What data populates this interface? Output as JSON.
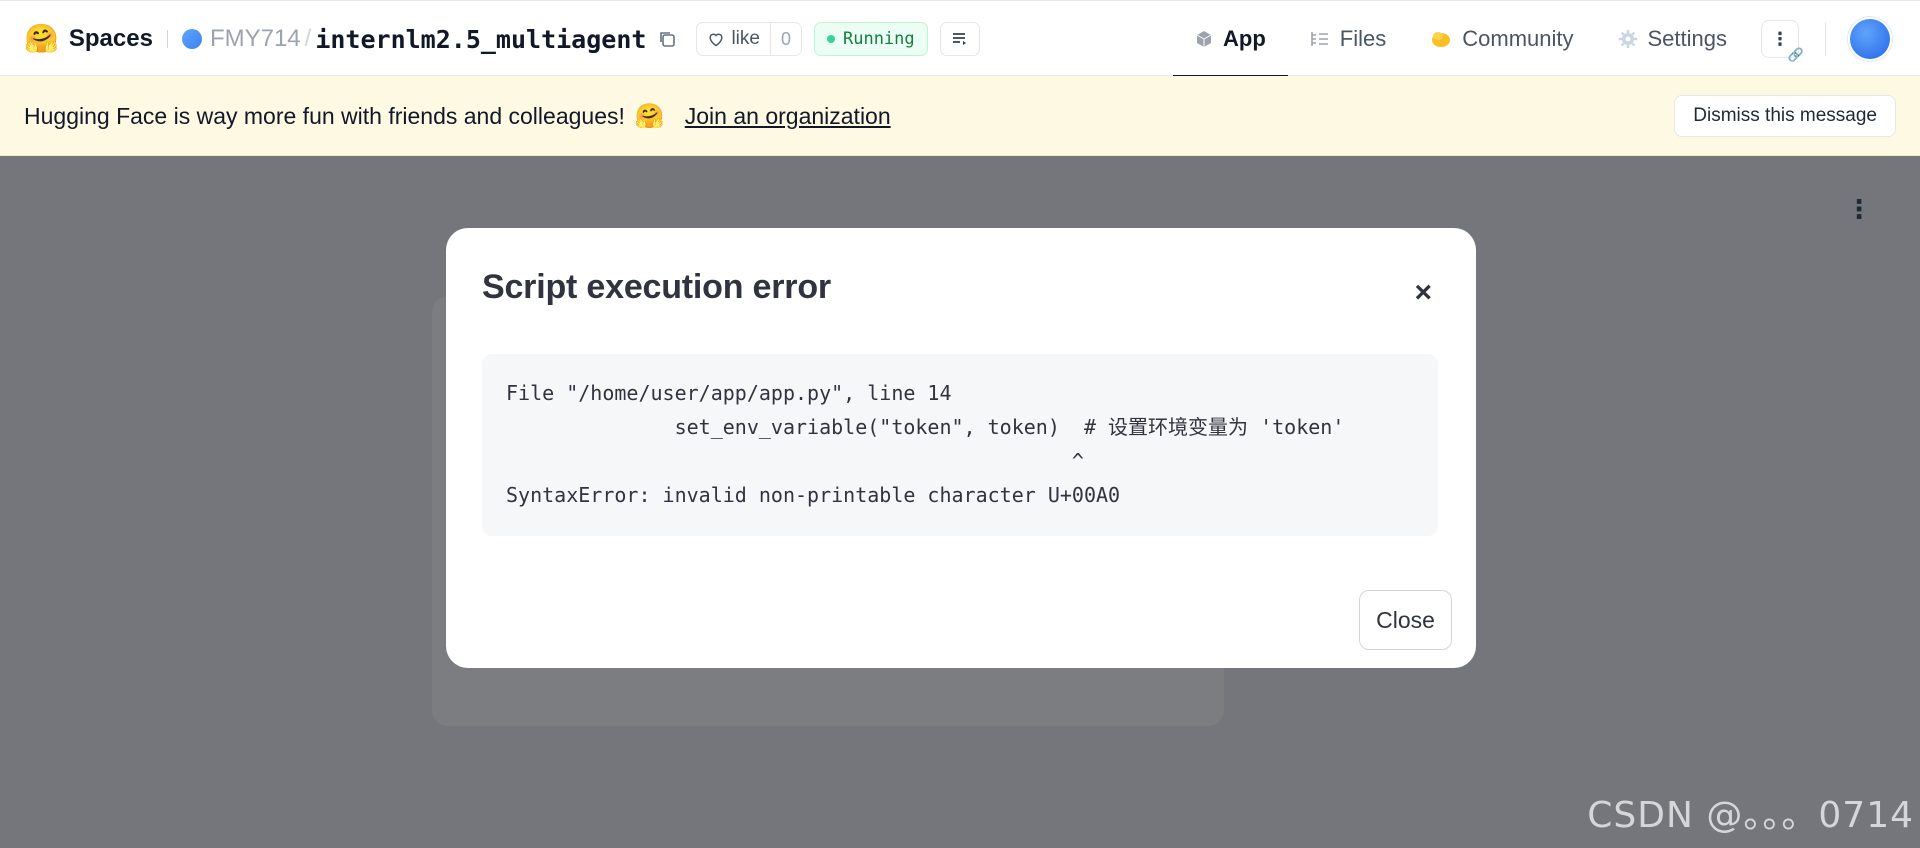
{
  "header": {
    "logo_emoji": "🤗",
    "spaces_label": "Spaces",
    "owner": "FMY714",
    "separator": "/",
    "repo_name": "internlm2.5_multiagent",
    "like_label": "like",
    "like_count": "0",
    "status_label": "Running",
    "tabs": [
      {
        "label": "App",
        "icon": "cube-icon",
        "active": true
      },
      {
        "label": "Files",
        "icon": "files-icon",
        "active": false
      },
      {
        "label": "Community",
        "icon": "community-icon",
        "active": false
      },
      {
        "label": "Settings",
        "icon": "gear-icon",
        "active": false
      }
    ],
    "more_label": "⋮"
  },
  "banner": {
    "message": "Hugging Face is way more fun with friends and colleagues!",
    "emoji": "🤗",
    "join_link": "Join an organization",
    "dismiss_label": "Dismiss this message"
  },
  "app": {
    "menu_glyph": "⋮"
  },
  "modal": {
    "title": "Script execution error",
    "close_glyph": "×",
    "code_lines": [
      "File \"/home/user/app/app.py\", line 14",
      "              set_env_variable(\"token\", token)  # 设置环境变量为 'token'",
      "                                               ^",
      "SyntaxError: invalid non-printable character U+00A0"
    ],
    "close_button": "Close"
  },
  "watermark": "CSDN @。。。0714",
  "colors": {
    "accent_running": "#15803d",
    "banner_bg": "#fef9e3",
    "overlay": "#74767b"
  }
}
